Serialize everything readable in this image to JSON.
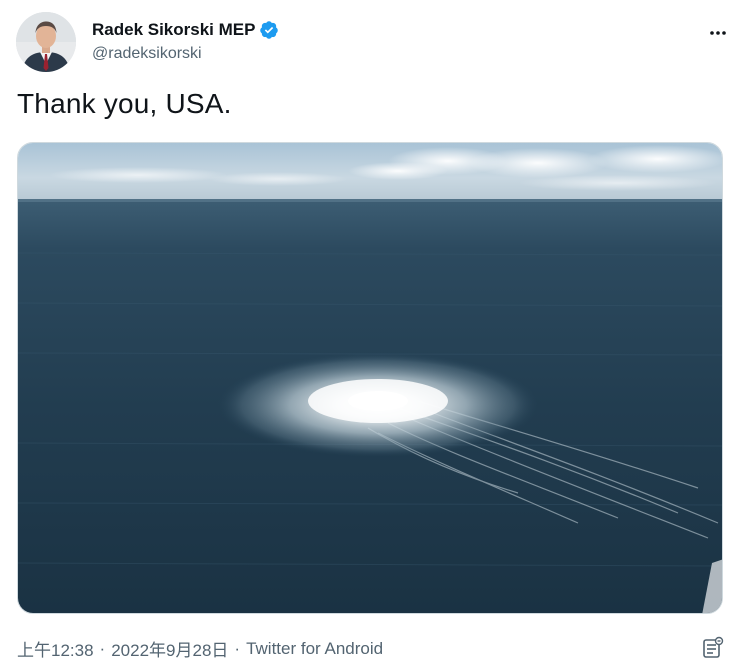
{
  "author": {
    "display_name": "Radek Sikorski MEP",
    "handle": "@radeksikorski",
    "verified": true
  },
  "tweet": {
    "text": "Thank you, USA."
  },
  "meta": {
    "time": "上午12:38",
    "date": "2022年9月28日",
    "source": "Twitter for Android",
    "separator": "·"
  },
  "icons": {
    "more": "more-horizontal-icon",
    "verified": "verified-badge-icon",
    "analytics": "tweet-analytics-icon"
  },
  "colors": {
    "verified_blue": "#1d9bf0",
    "secondary_text": "#536471",
    "primary_text": "#0f1419",
    "sea_dark": "#1b3547",
    "sea_mid": "#2a4a60"
  }
}
